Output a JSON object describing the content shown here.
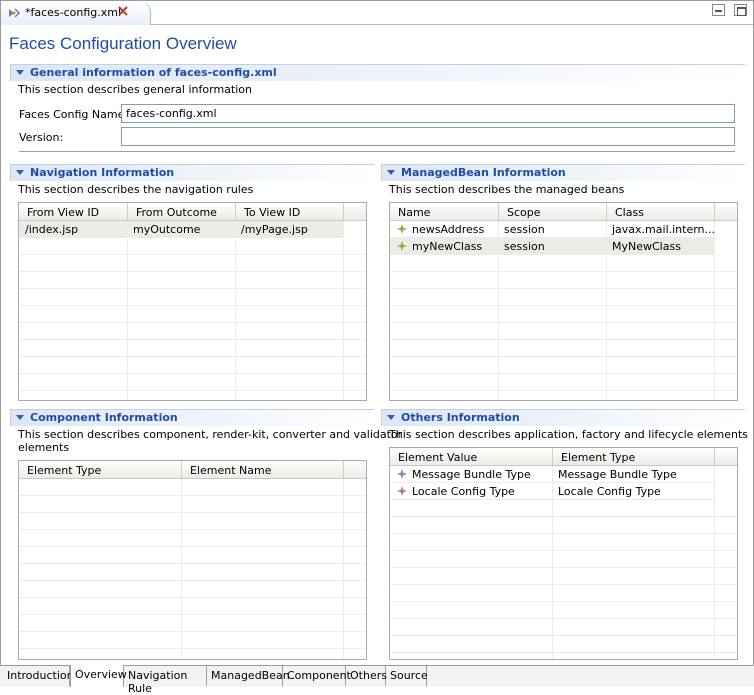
{
  "editor_tab": {
    "title": "*faces-config.xml"
  },
  "page_title": "Faces Configuration Overview",
  "general": {
    "title": "General information of faces-config.xml",
    "description": "This section describes general information",
    "faces_config_name_label": "Faces Config Name:",
    "faces_config_name_value": "faces-config.xml",
    "version_label": "Version:",
    "version_value": ""
  },
  "navigation": {
    "title": "Navigation Information",
    "description": "This section describes the navigation rules",
    "columns": [
      "From View ID",
      "From Outcome",
      "To View ID"
    ],
    "rows": [
      [
        "/index.jsp",
        "myOutcome",
        "/myPage.jsp"
      ]
    ]
  },
  "managed_bean": {
    "title": "ManagedBean Information",
    "description": "This section describes the managed beans",
    "columns": [
      "Name",
      "Scope",
      "Class"
    ],
    "rows": [
      [
        "newsAddress",
        "session",
        "javax.mail.intern..."
      ],
      [
        "myNewClass",
        "session",
        "MyNewClass"
      ]
    ],
    "row_icon": "bean-icon"
  },
  "component": {
    "title": "Component Information",
    "description_line1": "This section describes component, render-kit, converter and validator",
    "description_line2": "elements",
    "columns": [
      "Element Type",
      "Element Name"
    ]
  },
  "others": {
    "title": "Others Information",
    "description": "This section describes application, factory and lifecycle elements",
    "columns": [
      "Element Value",
      "Element Type"
    ],
    "rows": [
      [
        "Message Bundle Type",
        "Message Bundle Type"
      ],
      [
        "Locale Config Type",
        "Locale Config Type"
      ]
    ],
    "row_icon": "element-icon"
  },
  "bottom_tabs": [
    {
      "label": "Introduction",
      "active": false
    },
    {
      "label": "Overview",
      "active": true
    },
    {
      "label": "Navigation Rule",
      "active": false
    },
    {
      "label": "ManagedBean",
      "active": false
    },
    {
      "label": "Component",
      "active": false
    },
    {
      "label": "Others",
      "active": false
    },
    {
      "label": "Source",
      "active": false
    }
  ],
  "colors": {
    "title": "#1f4da6",
    "section_gradient_start": "#dde6f5",
    "selected_row": "#ecebe6"
  }
}
